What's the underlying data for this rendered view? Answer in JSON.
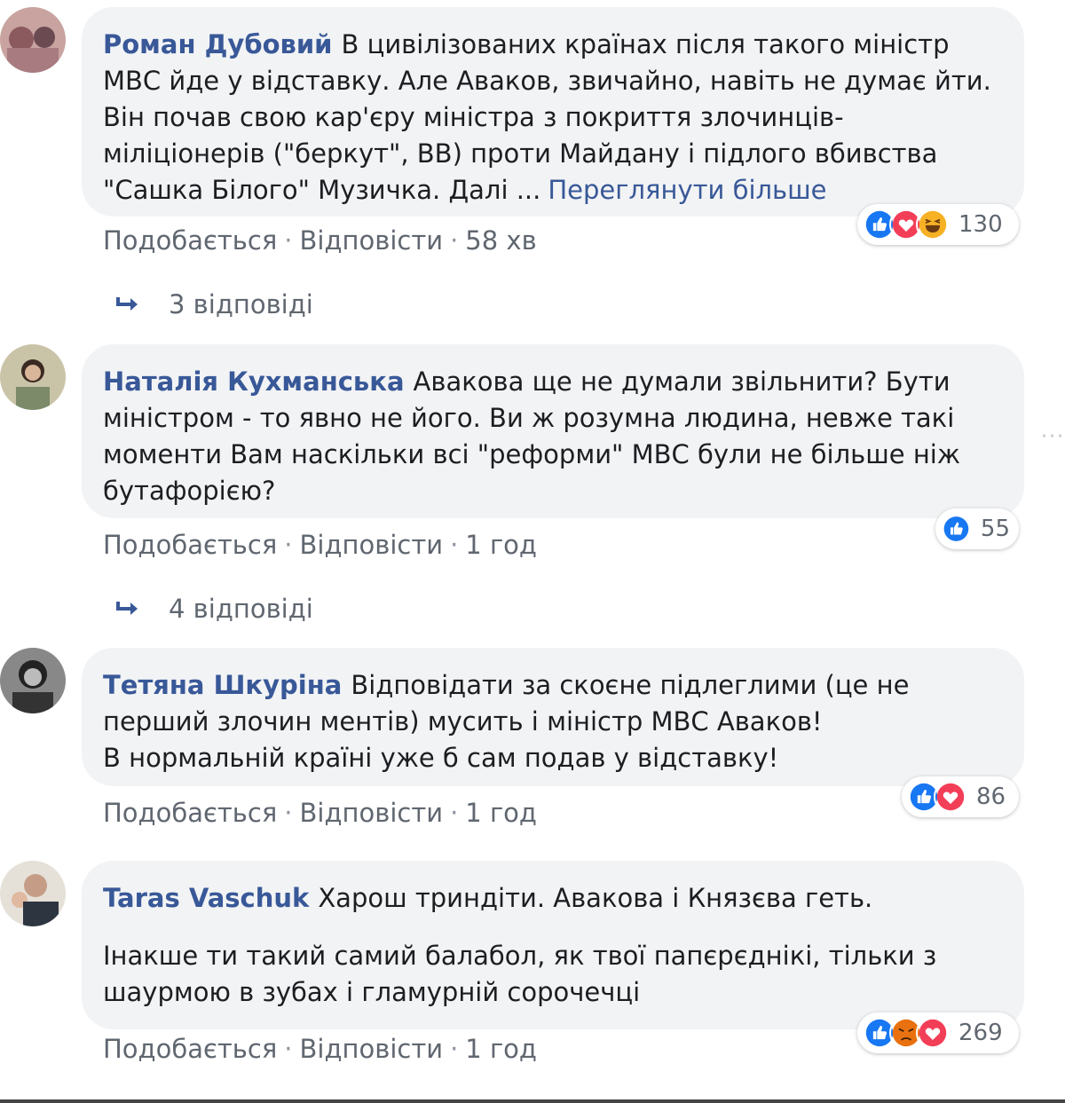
{
  "comments": [
    {
      "author": "Роман Дубовий",
      "text": "В цивілізованих країнах після такого міністр МВС йде у відставку. Але Аваков, звичайно, навіть не думає йти. Він почав свою кар'єру міністра з покриття злочинців-міліціонерів (\"беркут\", ВВ) проти Майдану і підлого вбивства \"Сашка Білого\" Музичка. Далі ...",
      "see_more": "Переглянути більше",
      "reaction_count": "130",
      "reactions": [
        "like-icon",
        "love-icon",
        "haha-icon"
      ],
      "like": "Подобається",
      "reply": "Відповісти",
      "time": "58 хв",
      "replies_label": "3 відповіді"
    },
    {
      "author": "Наталія Кухманська",
      "text": "Авакова ще не думали звільнити? Бути міністром - то явно не його. Ви ж розумна людина, невже такі моменти Вам наскільки всі \"реформи\" МВС були не більше ніж бутафорією?",
      "reaction_count": "55",
      "reactions": [
        "like-icon"
      ],
      "like": "Подобається",
      "reply": "Відповісти",
      "time": "1 год",
      "replies_label": "4 відповіді"
    },
    {
      "author": "Тетяна Шкуріна",
      "text": "Відповідати за скоєне підлеглими (це не перший злочин ментів) мусить і міністр МВС Аваков!\nВ нормальній країні уже б сам подав у відставку!",
      "reaction_count": "86",
      "reactions": [
        "like-icon",
        "love-icon"
      ],
      "like": "Подобається",
      "reply": "Відповісти",
      "time": "1 год"
    },
    {
      "author": "Taras Vaschuk",
      "text": "Харош триндіти. Авакова і Князєва геть.",
      "text2": "Інакше ти такий самий балабол, як твої папєрєднікі, тільки з шаурмою в зубах і гламурній сорочечці",
      "reaction_count": "269",
      "reactions": [
        "like-icon",
        "angry-icon",
        "love-icon"
      ],
      "like": "Подобається",
      "reply": "Відповісти",
      "time": "1 год"
    }
  ],
  "separator": "·",
  "colors": {
    "link": "#385898",
    "bubble": "#f2f3f5",
    "meta": "#606770",
    "like": "#1877f2",
    "love": "#f33e58"
  }
}
